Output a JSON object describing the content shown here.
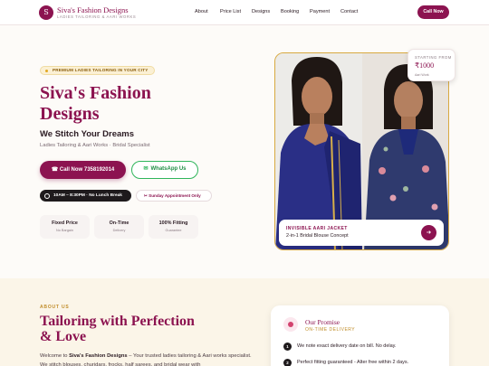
{
  "header": {
    "logo_letter": "S",
    "brand_name": "Siva's Fashion Designs",
    "brand_tagline": "LADIES TAILORING & AARI WORKS",
    "nav": [
      "About",
      "Price List",
      "Designs",
      "Booking",
      "Payment",
      "Contact"
    ],
    "cta": "Call Now"
  },
  "hero": {
    "badge": "PREMIUM LADIES TAILORING IN YOUR CITY",
    "title": "Siva's Fashion Designs",
    "subtitle": "We Stitch Your Dreams",
    "description": "Ladies Tailoring & Aari Works · Bridal Specialist",
    "call_button": "Call Now 7358192014",
    "whatsapp_button": "WhatsApp Us",
    "hours": "10AM – 8:30PM · No Lunch Break",
    "sunday": "Sunday Appointment Only",
    "features": [
      {
        "title": "Fixed Price",
        "sub": "No Bargain"
      },
      {
        "title": "On-Time",
        "sub": "Delivery"
      },
      {
        "title": "100% Fitting",
        "sub": "Guarantee"
      }
    ]
  },
  "showcase": {
    "price_label": "STARTING FROM",
    "price": "₹1000",
    "price_note": "Aari Work",
    "caption_title": "INVISIBLE AARI JACKET",
    "caption_sub": "2-in-1 Bridal Blouse Concept"
  },
  "about": {
    "label": "ABOUT US",
    "title": "Tailoring with Perfection & Love",
    "text_prefix": "Welcome to ",
    "text_brand": "Siva's Fashion Designs",
    "text_rest": " – Your trusted ladies tailoring & Aari works specialist. We stitch blouses, churidars, frocks, half sarees, and bridal wear with"
  },
  "promise": {
    "title": "Our Promise",
    "subtitle": "ON-TIME DELIVERY",
    "items": [
      {
        "num": "1",
        "text": "We note exact delivery date on bill. No delay."
      },
      {
        "num": "2",
        "text": "Perfect fitting guaranteed - Alter free within 2 days."
      }
    ]
  },
  "colors": {
    "brand": "#8c1350",
    "gold": "#c08d2a",
    "whatsapp": "#2fb55b",
    "dark": "#1e1a1c"
  },
  "icons": {
    "phone": "phone-icon",
    "whatsapp": "whatsapp-icon",
    "clock": "clock-icon",
    "scissors": "scissors-icon",
    "arrow": "arrow-right-icon",
    "promise": "badge-icon"
  }
}
